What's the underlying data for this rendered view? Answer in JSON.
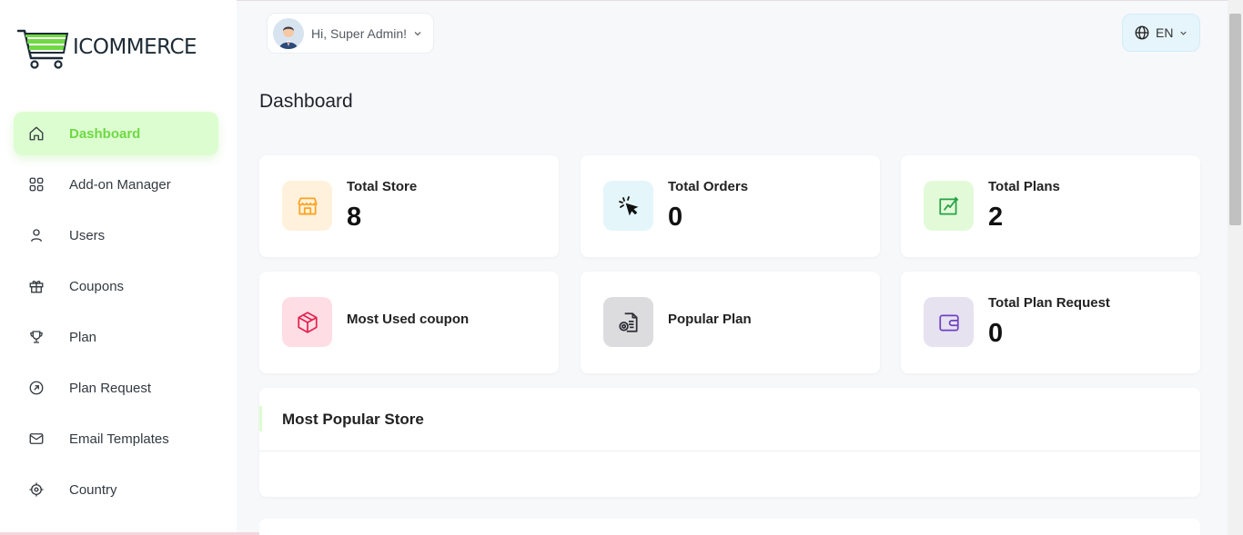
{
  "brand": {
    "name": "ICOMMERCE"
  },
  "header": {
    "greeting": "Hi, Super Admin!",
    "language": "EN"
  },
  "sidebar": {
    "items": [
      {
        "label": "Dashboard",
        "icon": "home-icon",
        "active": true
      },
      {
        "label": "Add-on Manager",
        "icon": "apps-icon",
        "active": false
      },
      {
        "label": "Users",
        "icon": "user-icon",
        "active": false
      },
      {
        "label": "Coupons",
        "icon": "gift-icon",
        "active": false
      },
      {
        "label": "Plan",
        "icon": "trophy-icon",
        "active": false
      },
      {
        "label": "Plan Request",
        "icon": "arrow-circle-icon",
        "active": false
      },
      {
        "label": "Email Templates",
        "icon": "mail-icon",
        "active": false
      },
      {
        "label": "Country",
        "icon": "location-icon",
        "active": false
      }
    ]
  },
  "main": {
    "title": "Dashboard",
    "cards": [
      {
        "label": "Total Store",
        "value": "8",
        "icon": "store-icon",
        "color": "#ffa21d"
      },
      {
        "label": "Total Orders",
        "value": "0",
        "icon": "cursor-click-icon",
        "color": "#3ec9d6"
      },
      {
        "label": "Total Plans",
        "value": "2",
        "icon": "chart-pencil-icon",
        "color": "#6fd943"
      },
      {
        "label": "Most Used coupon",
        "value": "",
        "icon": "box-icon",
        "color": "#ff3a6e"
      },
      {
        "label": "Popular Plan",
        "value": "",
        "icon": "document-gear-icon",
        "color": "#51459d"
      },
      {
        "label": "Total Plan Request",
        "value": "0",
        "icon": "wallet-icon",
        "color": "#6f42c1"
      }
    ],
    "popular_store": {
      "title": "Most Popular Store"
    }
  }
}
